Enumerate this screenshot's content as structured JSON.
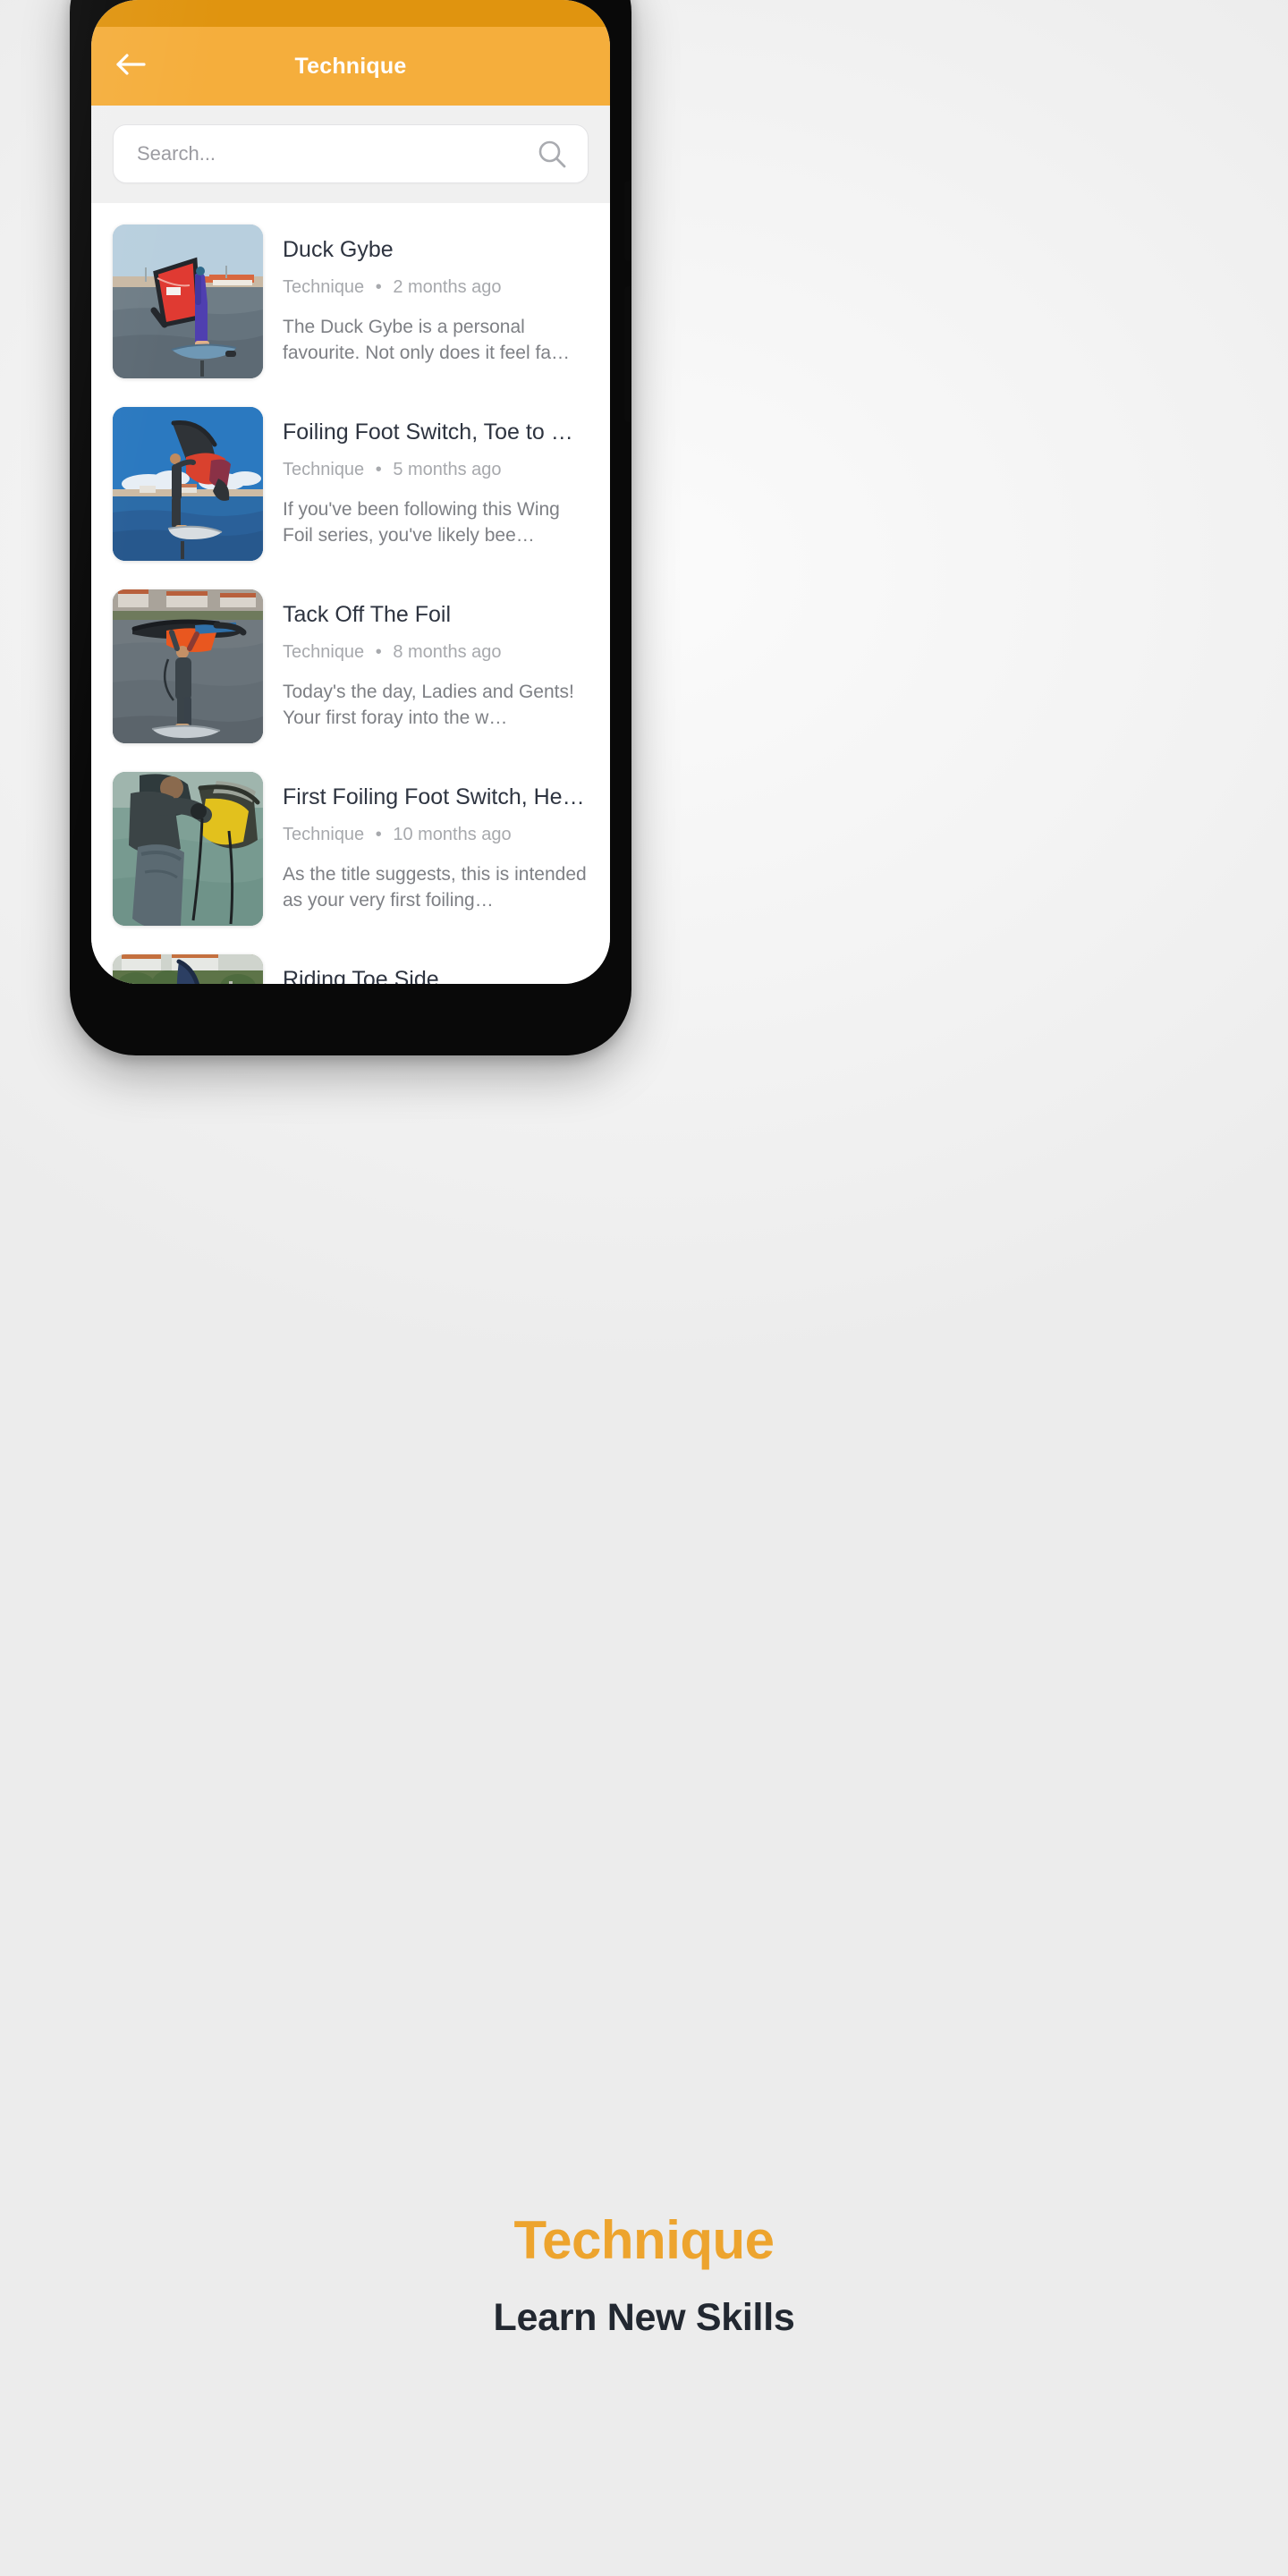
{
  "app": {
    "statusbar_color": "#e0940f",
    "appbar_color": "#f5ae3c",
    "title": "Technique",
    "back_icon": "arrow-left-icon"
  },
  "search": {
    "placeholder": "Search...",
    "value": "",
    "icon": "search-icon"
  },
  "list": [
    {
      "title": "Duck Gybe",
      "category": "Technique",
      "separator": "•",
      "age": "2 months ago",
      "excerpt": "The Duck Gybe is a personal favourite. Not only does it feel fa…",
      "image": "wingfoil-red-wing-purple-wetsuit"
    },
    {
      "title": "Foiling Foot Switch, Toe to He…",
      "category": "Technique",
      "separator": "•",
      "age": "5 months ago",
      "excerpt": "If you've been following this Wing Foil series, you've likely bee…",
      "image": "wingfoil-blue-sky-black-wetsuit"
    },
    {
      "title": "Tack Off The Foil",
      "category": "Technique",
      "separator": "•",
      "age": "8 months ago",
      "excerpt": "Today's the day, Ladies and Gents! Your first foray into the w…",
      "image": "wingfoil-orange-wing-overhead"
    },
    {
      "title": "First Foiling Foot Switch, Heel …",
      "category": "Technique",
      "separator": "•",
      "age": "10 months ago",
      "excerpt": "As the title suggests, this is intended as your very first foiling…",
      "image": "wingfoil-yellow-wing-closeup"
    },
    {
      "title": "Riding Toe Side",
      "category": "",
      "separator": "",
      "age": "",
      "excerpt": "",
      "image": "wingfoil-navy-wing-grass"
    }
  ],
  "captions": {
    "headline": "Technique",
    "headline_color": "#eda42e",
    "subhead": "Learn New Skills",
    "subhead_color": "#222831"
  }
}
